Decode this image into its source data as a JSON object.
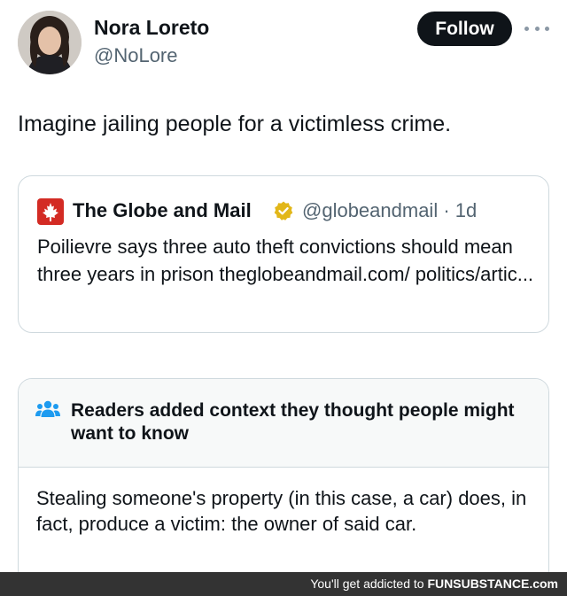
{
  "author": {
    "name": "Nora Loreto",
    "handle": "@NoLore",
    "follow_label": "Follow"
  },
  "tweet": {
    "text": "Imagine jailing people for a victimless crime."
  },
  "quoted": {
    "name": "The Globe and Mail",
    "verified": true,
    "handle_time": "@globeandmail · 1d",
    "body": "Poilievre says three auto theft convictions should mean three years in prison theglobeandmail.com/ politics/artic..."
  },
  "community_note": {
    "title": "Readers added context they thought people might want to know",
    "body": "Stealing someone's property (in this case, a car) does, in fact, produce a victim: the owner of said car."
  },
  "footer": {
    "prefix": "You'll get addicted to ",
    "brand": "FUNSUBSTANCE.com"
  },
  "colors": {
    "text_primary": "#0f1419",
    "text_secondary": "#536471",
    "follow_bg": "#0f1419",
    "border": "#cfd9de",
    "note_header_bg": "#f7f9f9",
    "note_icon": "#1d9bf0",
    "globe_logo": "#d32b24",
    "verified_badge": "#e2b719",
    "footer_bg": "#333333"
  },
  "icons": {
    "avatar": "profile-photo",
    "more": "more-horizontal-icon",
    "globe_logo": "maple-leaf-icon",
    "verified": "gold-verified-badge-icon",
    "note": "people-group-icon"
  }
}
